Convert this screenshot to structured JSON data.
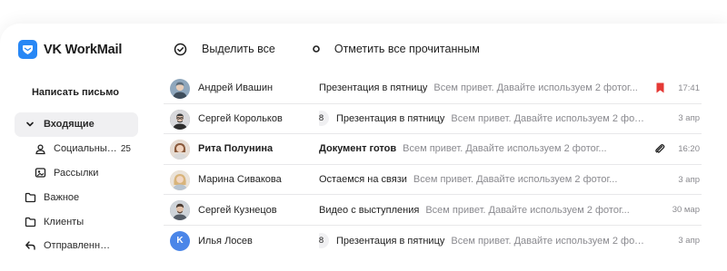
{
  "app": {
    "name": "VK WorkMail",
    "brand_color": "#2787f5"
  },
  "sidebar": {
    "compose_label": "Написать письмо",
    "items": [
      {
        "label": "Входящие",
        "icon": "chevron-down-icon",
        "active": true
      },
      {
        "label": "Социальные...",
        "icon": "people-icon",
        "count": "25"
      },
      {
        "label": "Рассылки",
        "icon": "newsletter-icon"
      },
      {
        "label": "Важное",
        "icon": "folder-icon"
      },
      {
        "label": "Клиенты",
        "icon": "folder-icon"
      },
      {
        "label": "Отправленные",
        "icon": "sent-icon"
      }
    ]
  },
  "toolbar": {
    "select_all_label": "Выделить все",
    "mark_all_read_label": "Отметить все прочитанным"
  },
  "messages": [
    {
      "sender": "Андрей Ивашин",
      "subject": "Презентация в пятницу",
      "snippet": "Всем привет. Давайте используем 2 фотог...",
      "date": "17:41",
      "avatar_color": "#8fa7bd",
      "bookmark": true,
      "bookmark_color": "#e53935"
    },
    {
      "sender": "Сергей Корольков",
      "count": "8",
      "subject": "Презентация в пятницу",
      "snippet": "Всем привет. Давайте используем 2 фотог...",
      "date": "3 апр",
      "avatar_color": "#6b6b6b"
    },
    {
      "sender": "Рита Полунина",
      "subject": "Документ готов",
      "snippet": "Всем привет. Давайте используем 2 фотог...",
      "date": "16:20",
      "avatar_color": "#c7a08a",
      "unread": true,
      "attachment": true
    },
    {
      "sender": "Марина Сивакова",
      "subject": "Остаемся на связи",
      "snippet": "Всем привет. Давайте используем 2 фотог...",
      "date": "3 апр",
      "avatar_color": "#d6b27c"
    },
    {
      "sender": "Сергей Кузнецов",
      "subject": "Видео с выступления",
      "snippet": "Всем привет. Давайте используем 2 фотог...",
      "date": "30 мар",
      "avatar_color": "#7d8590"
    },
    {
      "sender": "Илья Лосев",
      "count": "8",
      "subject": "Презентация в пятницу",
      "snippet": "Всем привет. Давайте используем 2 фотог...",
      "date": "3 апр",
      "avatar_color": "#4b86e8",
      "avatar_letter": "K"
    }
  ]
}
